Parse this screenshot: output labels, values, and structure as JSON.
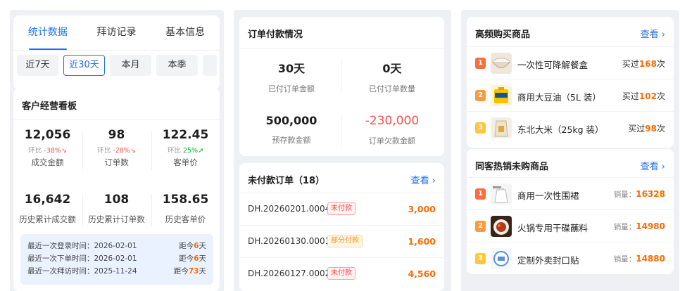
{
  "tabs": [
    {
      "label": "统计数据",
      "active": true
    },
    {
      "label": "拜访记录",
      "active": false
    },
    {
      "label": "基本信息",
      "active": false
    }
  ],
  "periods": [
    {
      "label": "近7天",
      "active": false
    },
    {
      "label": "近30天",
      "active": true
    },
    {
      "label": "本月",
      "active": false
    },
    {
      "label": "本季",
      "active": false
    }
  ],
  "dashboard": {
    "title": "客户经营看板",
    "metrics": [
      {
        "value": "12,056",
        "cmp_label": "环比",
        "cmp_value": "-38%",
        "trend": "down",
        "label": "成交金额"
      },
      {
        "value": "98",
        "cmp_label": "环比",
        "cmp_value": "-28%",
        "trend": "down",
        "label": "订单数"
      },
      {
        "value": "122.45",
        "cmp_label": "环比",
        "cmp_value": "25%",
        "trend": "up",
        "label": "客单价"
      }
    ],
    "history": [
      {
        "value": "16,642",
        "label": "历史累计成交额"
      },
      {
        "value": "108",
        "label": "历史累计订单数"
      },
      {
        "value": "158.65",
        "label": "历史客单价"
      }
    ],
    "info": [
      {
        "label": "最近一次登录时间：",
        "date": "2026-02-01",
        "ago_prefix": "距今",
        "ago_num": "6",
        "ago_unit": "天"
      },
      {
        "label": "最近一次下单时间：",
        "date": "2026-02-01",
        "ago_prefix": "距今",
        "ago_num": "6",
        "ago_unit": "天"
      },
      {
        "label": "最近一次拜访时间：",
        "date": "2025-11-24",
        "ago_prefix": "距今",
        "ago_num": "73",
        "ago_unit": "天"
      }
    ]
  },
  "payment": {
    "title": "订单付款情况",
    "items": [
      {
        "value": "30天",
        "label": "已付订单金额"
      },
      {
        "value": "0天",
        "label": "已付订单数量"
      },
      {
        "value": "500,000",
        "label": "预存款金额"
      },
      {
        "value": "-230,000",
        "label": "订单欠款金额"
      }
    ]
  },
  "unpaid": {
    "title": "未付款订单（18）",
    "link": "查看 ›",
    "orders": [
      {
        "id": "DH.20260201.0004",
        "tag": "未付款",
        "tag_type": "red",
        "amount": "3,000"
      },
      {
        "id": "DH.20260130.0001",
        "tag": "部分付款",
        "tag_type": "orange",
        "amount": "1,600"
      },
      {
        "id": "DH.20260127.0002",
        "tag": "未付款",
        "tag_type": "red",
        "amount": "4,560"
      }
    ]
  },
  "frequent": {
    "title": "高频购买商品",
    "link": "查看 ›",
    "items": [
      {
        "rank": "1",
        "name": "一次性可降解餐盒",
        "pre": "买过",
        "count": "168",
        "post": "次",
        "thumb": "bowl-thumb"
      },
      {
        "rank": "2",
        "name": "商用大豆油（5L 装）",
        "pre": "买过",
        "count": "102",
        "post": "次",
        "thumb": "oil-thumb"
      },
      {
        "rank": "3",
        "name": "东北大米（25kg 装）",
        "pre": "买过",
        "count": "98",
        "post": "次",
        "thumb": "rice-thumb"
      }
    ]
  },
  "peer": {
    "title": "同客热销未购商品",
    "link": "查看 ›",
    "items": [
      {
        "rank": "1",
        "name": "商用一次性围裙",
        "pre": "销量：",
        "count": "16328",
        "thumb": "apron-thumb"
      },
      {
        "rank": "2",
        "name": "火锅专用干碟蘸料",
        "pre": "销量：",
        "count": "14980",
        "thumb": "sauce-thumb"
      },
      {
        "rank": "3",
        "name": "定制外卖封口贴",
        "pre": "销量：",
        "count": "14880",
        "thumb": "sticker-thumb"
      }
    ]
  },
  "colors": {
    "accent": "#1f6feb",
    "orange": "#ff6a00",
    "red": "#ff4d4f",
    "green": "#00b42a"
  }
}
